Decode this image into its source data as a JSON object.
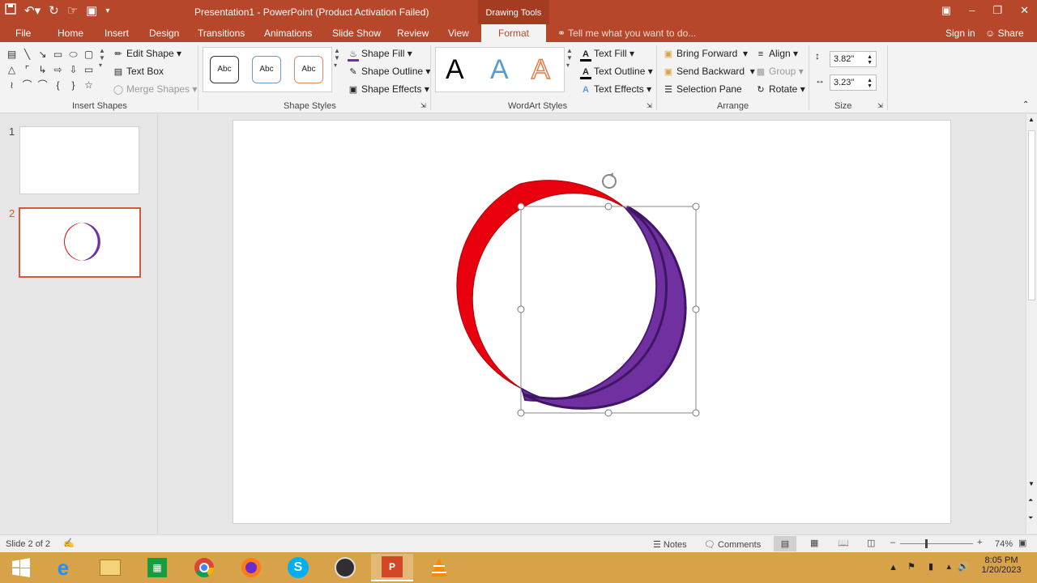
{
  "titlebar": {
    "title": "Presentation1 - PowerPoint (Product Activation Failed)",
    "context_tab": "Drawing Tools"
  },
  "tabs": [
    {
      "label": "File"
    },
    {
      "label": "Home"
    },
    {
      "label": "Insert"
    },
    {
      "label": "Design"
    },
    {
      "label": "Transitions"
    },
    {
      "label": "Animations"
    },
    {
      "label": "Slide Show"
    },
    {
      "label": "Review"
    },
    {
      "label": "View"
    },
    {
      "label": "Format",
      "active": true
    }
  ],
  "tell_me": "Tell me what you want to do...",
  "account": {
    "signin": "Sign in",
    "share": "Share"
  },
  "ribbon": {
    "insert_shapes": {
      "label": "Insert Shapes",
      "edit_shape": "Edit Shape",
      "text_box": "Text Box",
      "merge_shapes": "Merge Shapes"
    },
    "shape_styles": {
      "label": "Shape Styles",
      "presets": [
        "Abc",
        "Abc",
        "Abc"
      ],
      "shape_fill": "Shape Fill",
      "shape_outline": "Shape Outline",
      "shape_effects": "Shape Effects"
    },
    "wordart_styles": {
      "label": "WordArt Styles",
      "presets": [
        "A",
        "A",
        "A"
      ],
      "text_fill": "Text Fill",
      "text_outline": "Text Outline",
      "text_effects": "Text Effects"
    },
    "arrange": {
      "label": "Arrange",
      "bring_forward": "Bring Forward",
      "send_backward": "Send Backward",
      "selection_pane": "Selection Pane",
      "align": "Align",
      "group": "Group",
      "rotate": "Rotate"
    },
    "size": {
      "label": "Size",
      "height": "3.82\"",
      "width": "3.23\""
    }
  },
  "slides": [
    {
      "number": "1"
    },
    {
      "number": "2",
      "selected": true
    }
  ],
  "shape": {
    "red_color": "#e8000e",
    "purple_color": "#7030a0"
  },
  "status": {
    "slide_count": "Slide 2 of 2",
    "notes": "Notes",
    "comments": "Comments",
    "zoom": "74%"
  },
  "taskbar": {
    "time": "8:05 PM",
    "date": "1/20/2023"
  },
  "colors": {
    "accent": "#b7472a",
    "taskbar": "#d8a24a"
  }
}
